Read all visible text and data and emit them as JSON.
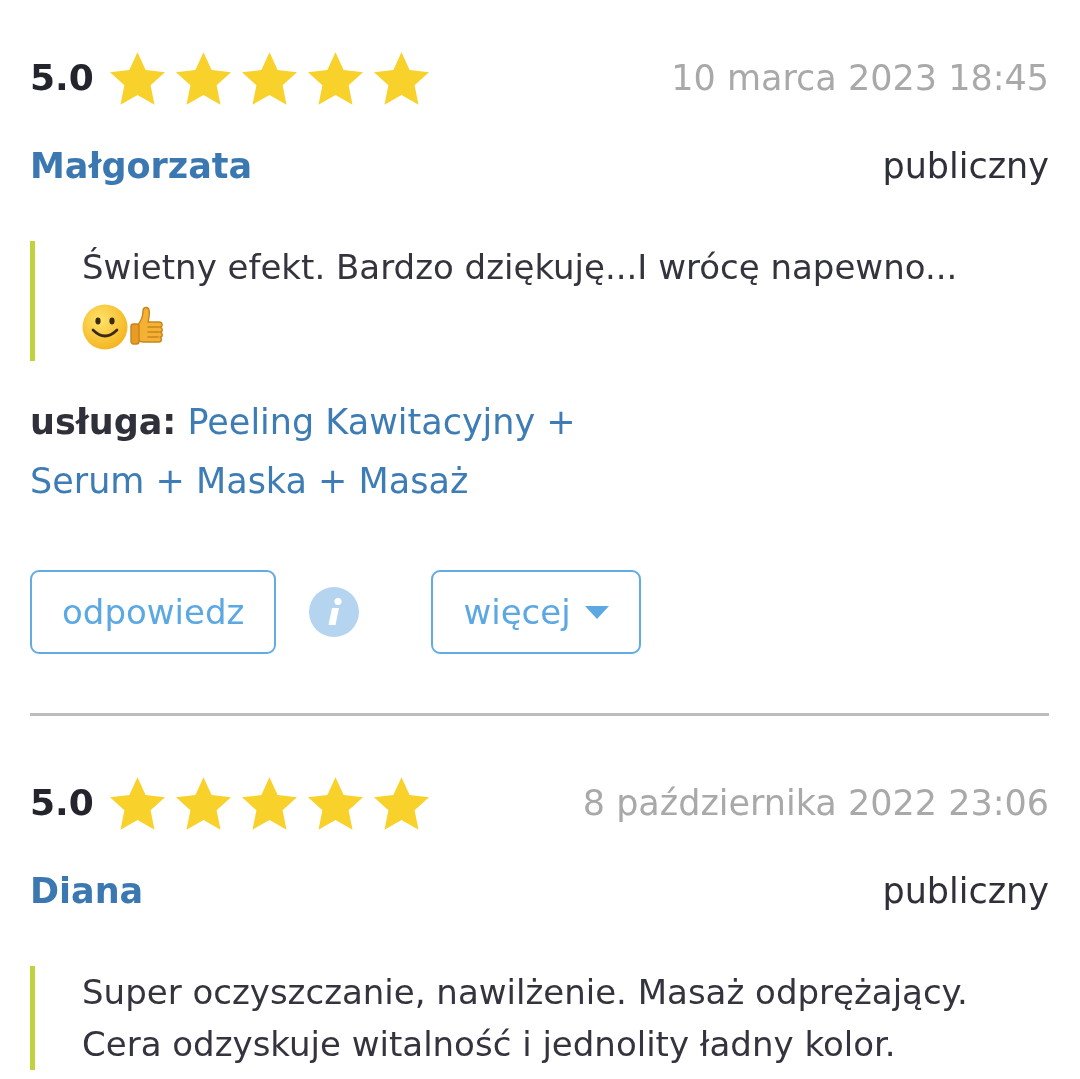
{
  "reviews": [
    {
      "rating": "5.0",
      "stars": 5,
      "date": "10 marca 2023 18:45",
      "author": "Małgorzata",
      "visibility": "publiczny",
      "text": "Świetny efekt. Bardzo dziękuję...I wrócę napewno...",
      "emojis": [
        {
          "kind": "smile"
        },
        {
          "kind": "thumbsup"
        }
      ],
      "service": "**usługa:** Peeling Kawitacyjny + Serum + Maska + Masaż",
      "actions": [
        {
          "kind": "reply",
          "label": "odpowiedz"
        },
        {
          "kind": "info"
        },
        {
          "kind": "more",
          "label": "więcej"
        }
      ]
    },
    {
      "rating": "5.0",
      "stars": 5,
      "date": "8 października 2022 23:06",
      "author": "Diana",
      "visibility": "publiczny",
      "text": "Super oczyszczanie, nawilżenie. Masaż odprężający. Cera odzyskuje witalność i jednolity ładny kolor."
    }
  ]
}
